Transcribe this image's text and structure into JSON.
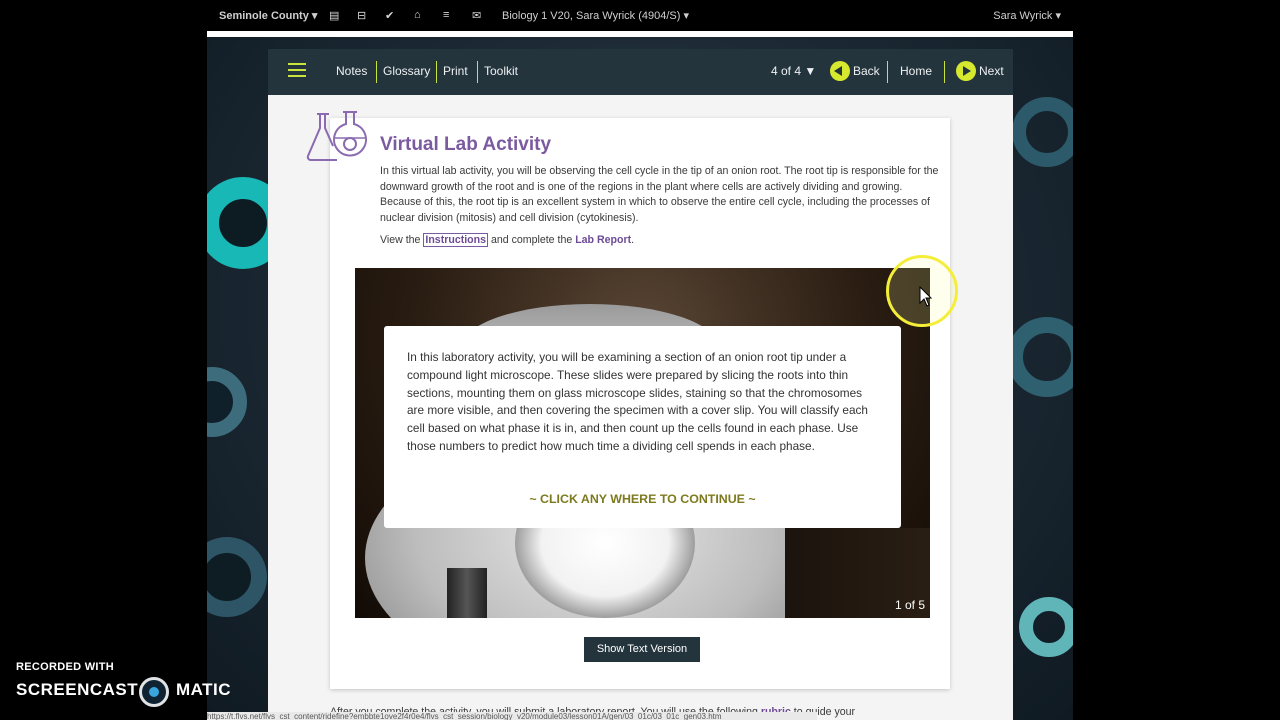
{
  "topbar": {
    "county": "Seminole County",
    "course": "Biology 1 V20, Sara Wyrick (4904/S)",
    "user": "Sara Wyrick"
  },
  "nav": {
    "notes": "Notes",
    "glossary": "Glossary",
    "print": "Print",
    "toolkit": "Toolkit",
    "page_indicator": "4 of 4 ▼",
    "back": "Back",
    "home": "Home",
    "next": "Next"
  },
  "lesson": {
    "title": "Virtual Lab Activity",
    "intro": "In this virtual lab activity, you will be observing the cell cycle in the tip of an onion root. The root tip is responsible for the downward growth of the root and is one of the regions in the plant where cells are actively dividing and growing. Because of this, the root tip is an excellent system in which to observe the entire cell cycle, including the processes of nuclear division (mitosis) and cell division (cytokinesis).",
    "view_prefix": "View the ",
    "instructions_link": "Instructions",
    "view_middle": " and complete the ",
    "lab_report_link": "Lab Report",
    "view_suffix": "."
  },
  "slide": {
    "popup_text": "In this laboratory activity, you will be examining a section of an onion root tip under a compound light microscope. These slides were prepared by slicing the roots into thin sections, mounting them on glass microscope slides, staining so that the chromosomes are more visible, and then covering the specimen with a cover slip. You will classify each cell based on what phase it is in, and then count up the cells found in each phase. Use those numbers to predict how much time a dividing cell spends in each phase.",
    "continue": "~ CLICK ANY WHERE TO CONTINUE ~",
    "counter": "1 of 5"
  },
  "show_text_version": "Show Text Version",
  "bottom": {
    "prefix": "After you complete the activity, you will submit a laboratory report. You will use the following ",
    "rubric": "rubric",
    "suffix": " to guide your"
  },
  "status_url": "https://t.flvs.net/flvs_cst_content/ridefine?embbte1ove2f4r0e4/flvs_cst_session/biology_v20/module03/lesson01A/gen/03_01c/03_01c_gen03.htm",
  "watermark": {
    "line1": "RECORDED WITH",
    "brand_left": "SCREENCAST",
    "brand_right": "MATIC"
  },
  "colors": {
    "accent_purple": "#7b5aa0",
    "nav_dark": "#24343d",
    "nav_accent": "#c8e33b"
  }
}
